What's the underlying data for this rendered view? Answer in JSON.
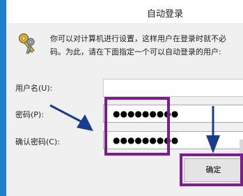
{
  "window": {
    "title": "自动登录"
  },
  "description": {
    "line1": "你可以对计算机进行设置，这样用户在登录时就不必",
    "line2": "码。为此，请在下面指定一个可以自动登录的用户:"
  },
  "fields": {
    "username": {
      "label": "用户名(U):",
      "value": ""
    },
    "password": {
      "label": "密码(P):",
      "value": "●●●●●●●●●"
    },
    "confirm": {
      "label": "确认密码(C):",
      "value": "●●●●●●●●●"
    }
  },
  "buttons": {
    "ok_label": "确定"
  },
  "icons": {
    "keys": "keys-icon"
  },
  "colors": {
    "accent_border": "#1e7fd1",
    "highlight": "#7b1d8e",
    "arrow": "#1a3c8f"
  }
}
